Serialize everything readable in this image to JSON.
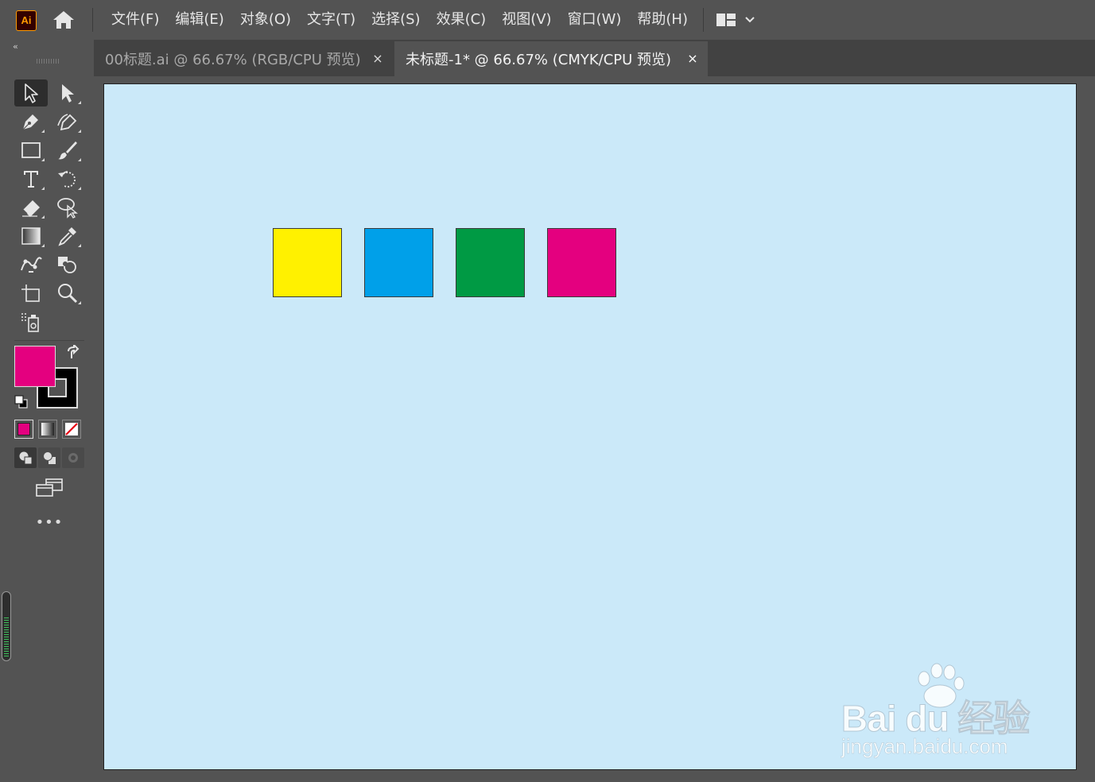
{
  "app": {
    "logo_text": "Ai",
    "brand_color": "#ff9a00"
  },
  "menu": {
    "items": [
      "文件(F)",
      "编辑(E)",
      "对象(O)",
      "文字(T)",
      "选择(S)",
      "效果(C)",
      "视图(V)",
      "窗口(W)",
      "帮助(H)"
    ]
  },
  "tabs": [
    {
      "label": "00标题.ai @ 66.67% (RGB/CPU 预览)",
      "close": "×",
      "active": false
    },
    {
      "label": "未标题-1* @ 66.67% (CMYK/CPU 预览)",
      "close": "×",
      "active": true
    }
  ],
  "toolbar": {
    "collapse": "‹‹",
    "tools": [
      {
        "name": "selection-tool-icon",
        "selected": true
      },
      {
        "name": "direct-selection-tool-icon"
      },
      {
        "name": "pen-tool-icon"
      },
      {
        "name": "curvature-tool-icon"
      },
      {
        "name": "rectangle-tool-icon"
      },
      {
        "name": "paintbrush-tool-icon"
      },
      {
        "name": "type-tool-icon"
      },
      {
        "name": "rotate-tool-icon"
      },
      {
        "name": "eraser-tool-icon"
      },
      {
        "name": "lasso-tool-icon"
      },
      {
        "name": "gradient-tool-icon"
      },
      {
        "name": "eyedropper-tool-icon"
      },
      {
        "name": "puppet-warp-tool-icon"
      },
      {
        "name": "shape-builder-tool-icon"
      },
      {
        "name": "artboard-tool-icon"
      },
      {
        "name": "zoom-tool-icon"
      },
      {
        "name": "symbol-sprayer-tool-icon"
      }
    ],
    "fill_color": "#e4007f",
    "stroke_color": "#000000",
    "more": "•••"
  },
  "canvas": {
    "artboard_color": "#cbe9f9",
    "squares": [
      {
        "name": "yellow-square",
        "color": "#fff100"
      },
      {
        "name": "cyan-square",
        "color": "#00a0e9"
      },
      {
        "name": "green-square",
        "color": "#009a44"
      },
      {
        "name": "magenta-square",
        "color": "#e4007f"
      }
    ]
  },
  "watermark": {
    "main": "Bai du 经验",
    "sub": "jingyan.baidu.com"
  }
}
